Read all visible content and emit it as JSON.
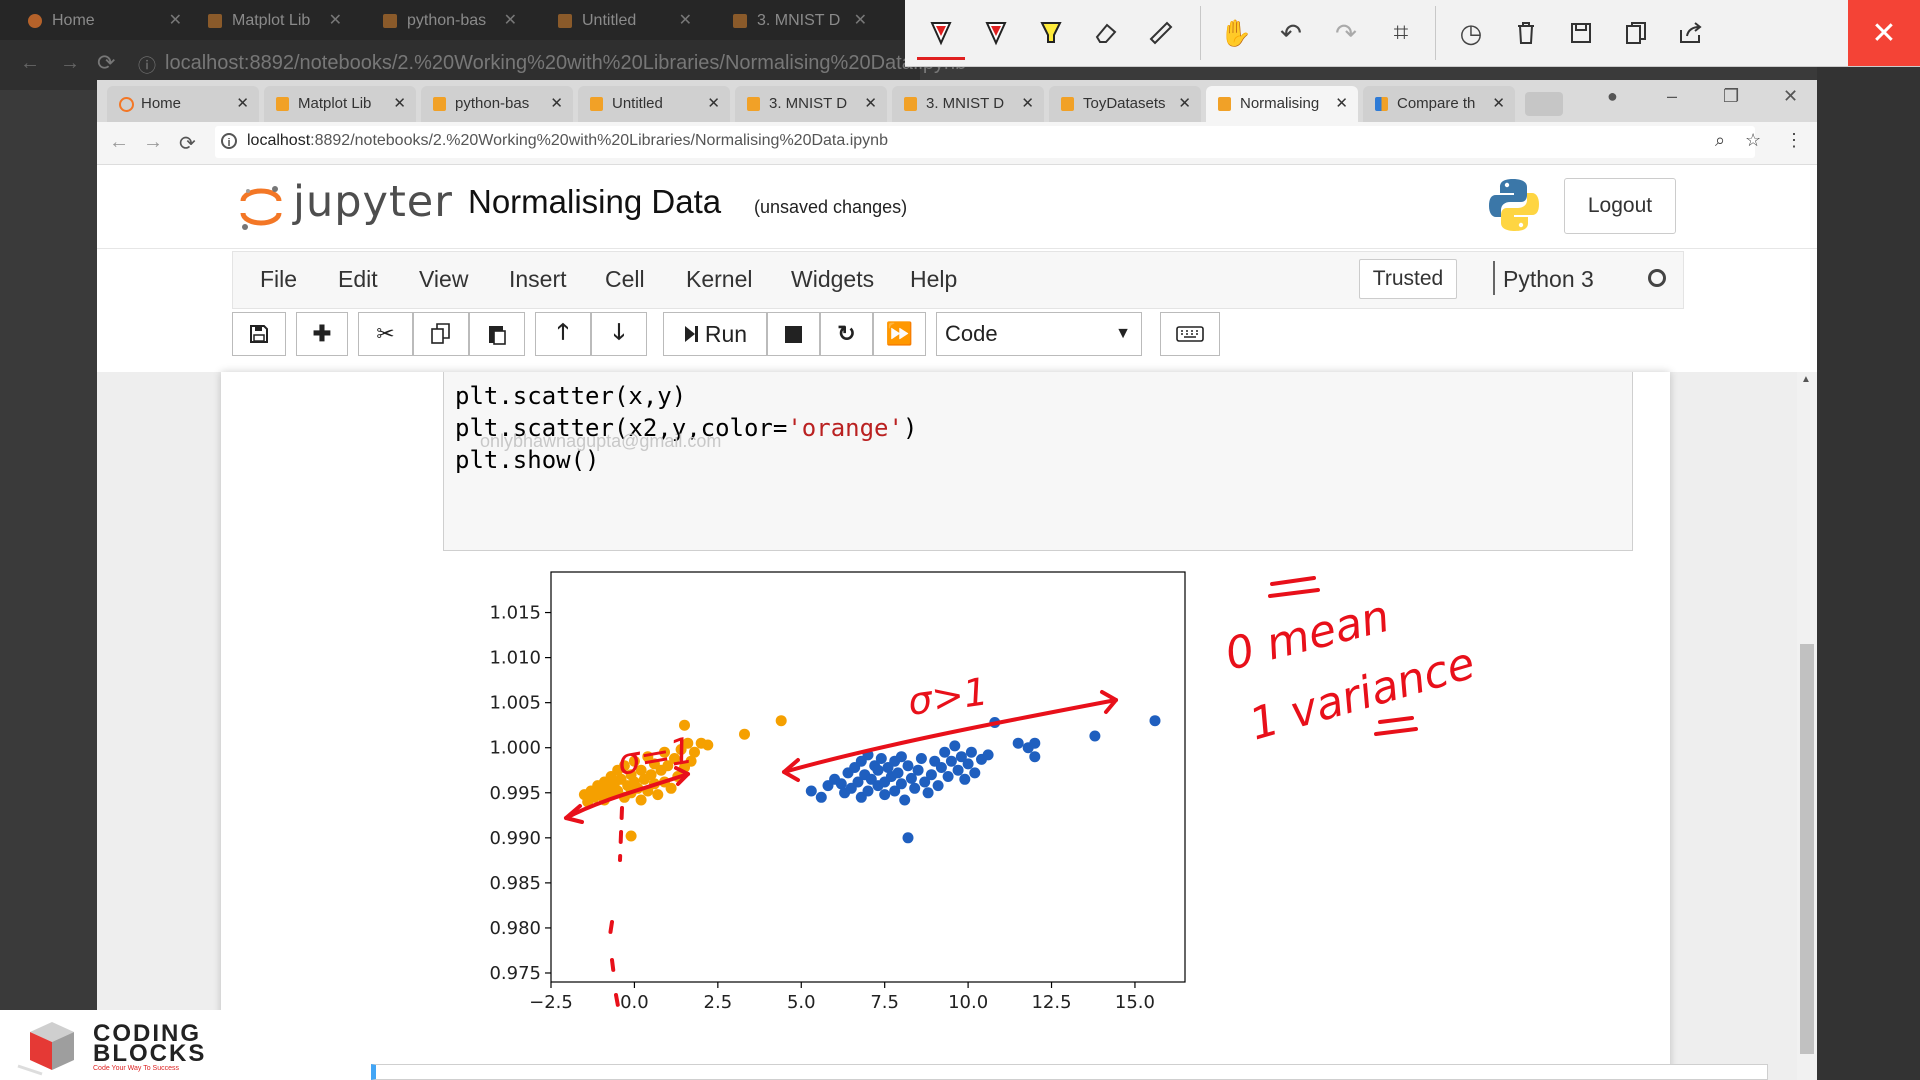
{
  "outer_browser": {
    "tabs": [
      "Home",
      "Matplot Lib",
      "python-bas",
      "Untitled",
      "3. MNIST D"
    ],
    "url": "localhost:8892/notebooks/2.%20Working%20with%20Libraries/Normalising%20Data.ipynb"
  },
  "annotation_toolbar": {
    "tools": [
      "pen-red-icon",
      "pen-red-icon",
      "highlighter-icon",
      "eraser-icon",
      "ruler-icon",
      "touch-icon",
      "undo-icon",
      "redo-icon",
      "crop-icon",
      "history-icon",
      "trash-icon",
      "save-icon",
      "copy-icon",
      "share-icon",
      "close-icon"
    ],
    "close_glyph": "✕"
  },
  "browser": {
    "tabs": [
      {
        "label": "Home",
        "icon": "jupyter-icon"
      },
      {
        "label": "Matplot Lib",
        "icon": "notebook-icon"
      },
      {
        "label": "python-bas",
        "icon": "notebook-icon"
      },
      {
        "label": "Untitled",
        "icon": "notebook-icon"
      },
      {
        "label": "3. MNIST D",
        "icon": "notebook-icon"
      },
      {
        "label": "3. MNIST D",
        "icon": "notebook-icon"
      },
      {
        "label": "ToyDatasets",
        "icon": "notebook-icon"
      },
      {
        "label": "Normalising",
        "icon": "notebook-icon"
      },
      {
        "label": "Compare th",
        "icon": "chart-icon"
      }
    ],
    "url_host": "localhost",
    "url_rest": ":8892/notebooks/2.%20Working%20with%20Libraries/Normalising%20Data.ipynb"
  },
  "jupyter": {
    "logo_text": "jupyter",
    "notebook_title": "Normalising Data",
    "save_status": "(unsaved changes)",
    "logout": "Logout",
    "menu": [
      "File",
      "Edit",
      "View",
      "Insert",
      "Cell",
      "Kernel",
      "Widgets",
      "Help"
    ],
    "trusted": "Trusted",
    "kernel": "Python 3",
    "toolbar": {
      "run_label": "Run",
      "cell_type": "Code"
    }
  },
  "cell": {
    "lines": [
      {
        "pre": "plt.scatter(x,y)",
        "str": "",
        "post": ""
      },
      {
        "pre": "plt.scatter(x2,y,color=",
        "str": "'orange'",
        "post": ")"
      },
      {
        "pre": "plt.show()",
        "str": "",
        "post": ""
      }
    ],
    "watermark_email": "onlybhawnagupta@gmail.com"
  },
  "chart_data": {
    "type": "scatter",
    "xlim": [
      -2.5,
      16.5
    ],
    "ylim": [
      0.974,
      1.0195
    ],
    "xticks": [
      -2.5,
      0.0,
      2.5,
      5.0,
      7.5,
      10.0,
      12.5,
      15.0
    ],
    "xtick_labels": [
      "−2.5",
      "0.0",
      "2.5",
      "5.0",
      "7.5",
      "10.0",
      "12.5",
      "15.0"
    ],
    "yticks": [
      0.975,
      0.98,
      0.985,
      0.99,
      0.995,
      1.0,
      1.005,
      1.01,
      1.015
    ],
    "ytick_labels": [
      "0.975",
      "0.980",
      "0.985",
      "0.990",
      "0.995",
      "1.000",
      "1.005",
      "1.010",
      "1.015"
    ],
    "series": [
      {
        "color": "#1f5fbf",
        "points": [
          [
            5.3,
            0.9952
          ],
          [
            5.6,
            0.9945
          ],
          [
            5.8,
            0.9958
          ],
          [
            6.0,
            0.9965
          ],
          [
            6.2,
            0.996
          ],
          [
            6.3,
            0.995
          ],
          [
            6.4,
            0.9972
          ],
          [
            6.5,
            0.9955
          ],
          [
            6.6,
            0.9978
          ],
          [
            6.7,
            0.9962
          ],
          [
            6.8,
            0.9945
          ],
          [
            6.8,
            0.9985
          ],
          [
            6.9,
            0.997
          ],
          [
            7.0,
            0.9952
          ],
          [
            7.0,
            0.9992
          ],
          [
            7.1,
            0.9965
          ],
          [
            7.2,
            0.998
          ],
          [
            7.3,
            0.9958
          ],
          [
            7.3,
            0.9975
          ],
          [
            7.4,
            0.9988
          ],
          [
            7.5,
            0.9962
          ],
          [
            7.5,
            0.9948
          ],
          [
            7.6,
            0.9978
          ],
          [
            7.7,
            0.9968
          ],
          [
            7.8,
            0.9985
          ],
          [
            7.8,
            0.9952
          ],
          [
            7.9,
            0.9972
          ],
          [
            8.0,
            0.999
          ],
          [
            8.0,
            0.996
          ],
          [
            8.1,
            0.9942
          ],
          [
            8.2,
            0.998
          ],
          [
            8.3,
            0.9966
          ],
          [
            8.4,
            0.9955
          ],
          [
            8.5,
            0.9975
          ],
          [
            8.6,
            0.9988
          ],
          [
            8.7,
            0.9962
          ],
          [
            8.8,
            0.995
          ],
          [
            8.9,
            0.997
          ],
          [
            9.0,
            0.9985
          ],
          [
            9.1,
            0.9958
          ],
          [
            9.2,
            0.9978
          ],
          [
            9.3,
            0.9995
          ],
          [
            9.4,
            0.9968
          ],
          [
            9.5,
            0.9985
          ],
          [
            9.6,
            1.0002
          ],
          [
            9.7,
            0.9975
          ],
          [
            9.8,
            0.999
          ],
          [
            9.9,
            0.9965
          ],
          [
            10.0,
            0.9982
          ],
          [
            10.1,
            0.9995
          ],
          [
            10.2,
            0.9972
          ],
          [
            10.4,
            0.9987
          ],
          [
            10.6,
            0.9992
          ],
          [
            10.8,
            1.0028
          ],
          [
            11.5,
            1.0005
          ],
          [
            11.8,
            1.0
          ],
          [
            12.0,
            0.999
          ],
          [
            12.0,
            1.0005
          ],
          [
            13.8,
            1.0013
          ],
          [
            15.6,
            1.003
          ],
          [
            8.2,
            0.99
          ]
        ]
      },
      {
        "color": "#f5a000",
        "points": [
          [
            -1.5,
            0.9948
          ],
          [
            -1.4,
            0.994
          ],
          [
            -1.3,
            0.9952
          ],
          [
            -1.2,
            0.9945
          ],
          [
            -1.1,
            0.9958
          ],
          [
            -1.0,
            0.995
          ],
          [
            -0.9,
            0.9962
          ],
          [
            -0.9,
            0.9942
          ],
          [
            -0.8,
            0.9955
          ],
          [
            -0.7,
            0.9968
          ],
          [
            -0.7,
            0.9948
          ],
          [
            -0.6,
            0.996
          ],
          [
            -0.5,
            0.9975
          ],
          [
            -0.5,
            0.9952
          ],
          [
            -0.4,
            0.9965
          ],
          [
            -0.3,
            0.9945
          ],
          [
            -0.3,
            0.998
          ],
          [
            -0.2,
            0.9958
          ],
          [
            -0.1,
            0.997
          ],
          [
            -0.1,
            0.995
          ],
          [
            0.0,
            0.9962
          ],
          [
            0.0,
            0.9985
          ],
          [
            0.1,
            0.9955
          ],
          [
            0.2,
            0.9975
          ],
          [
            0.2,
            0.9942
          ],
          [
            0.3,
            0.9965
          ],
          [
            0.4,
            0.999
          ],
          [
            0.4,
            0.9952
          ],
          [
            0.5,
            0.997
          ],
          [
            0.6,
            0.996
          ],
          [
            0.6,
            0.9982
          ],
          [
            0.7,
            0.9948
          ],
          [
            0.8,
            0.9975
          ],
          [
            0.9,
            0.9995
          ],
          [
            0.9,
            0.9962
          ],
          [
            1.0,
            0.998
          ],
          [
            1.1,
            0.9955
          ],
          [
            1.2,
            0.9988
          ],
          [
            1.3,
            0.9968
          ],
          [
            1.4,
            0.9998
          ],
          [
            1.5,
            0.9978
          ],
          [
            1.6,
            1.0005
          ],
          [
            1.7,
            0.9985
          ],
          [
            1.8,
            0.9995
          ],
          [
            2.0,
            1.0005
          ],
          [
            2.2,
            1.0003
          ],
          [
            1.5,
            1.0025
          ],
          [
            3.3,
            1.0015
          ],
          [
            4.4,
            1.003
          ],
          [
            -0.1,
            0.9902
          ]
        ]
      }
    ]
  },
  "ink_text": {
    "sigma_small": "σ=1",
    "sigma_large": "σ>1",
    "mean_line": "0 mean",
    "variance_line": "1 variance"
  },
  "brand": {
    "line1": "CODING",
    "line2": "BLOCKS",
    "tagline": "Code Your Way To Success"
  }
}
